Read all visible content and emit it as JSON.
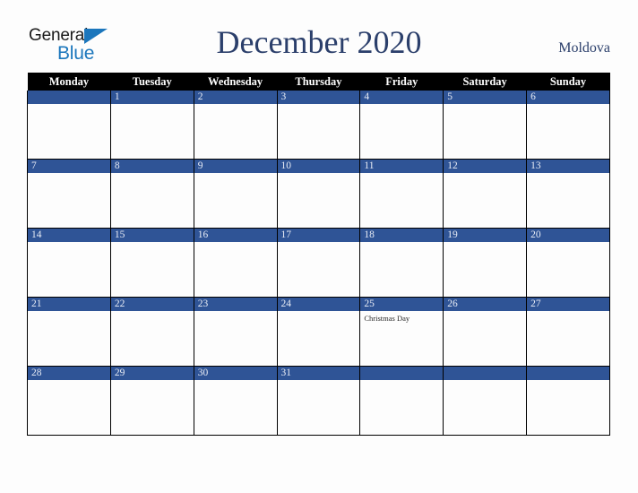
{
  "brand": {
    "line1": "General",
    "line2": "Blue",
    "triangle_icon": "blue-triangle-icon",
    "text_color": "#1a1a1a",
    "accent_color": "#1b76bc"
  },
  "header": {
    "title": "December 2020",
    "country": "Moldova",
    "title_color": "#2b3f6b"
  },
  "calendar": {
    "weekday_headers": [
      "Monday",
      "Tuesday",
      "Wednesday",
      "Thursday",
      "Friday",
      "Saturday",
      "Sunday"
    ],
    "header_bg": "#000000",
    "header_text_color": "#ffffff",
    "date_band_color": "#2f5496",
    "date_text_color": "#e8ecf5",
    "cell_bg": "#fdfdfd",
    "grid_line_color": "#000000",
    "weeks": [
      [
        {
          "date": "",
          "events": []
        },
        {
          "date": "1",
          "events": []
        },
        {
          "date": "2",
          "events": []
        },
        {
          "date": "3",
          "events": []
        },
        {
          "date": "4",
          "events": []
        },
        {
          "date": "5",
          "events": []
        },
        {
          "date": "6",
          "events": []
        }
      ],
      [
        {
          "date": "7",
          "events": []
        },
        {
          "date": "8",
          "events": []
        },
        {
          "date": "9",
          "events": []
        },
        {
          "date": "10",
          "events": []
        },
        {
          "date": "11",
          "events": []
        },
        {
          "date": "12",
          "events": []
        },
        {
          "date": "13",
          "events": []
        }
      ],
      [
        {
          "date": "14",
          "events": []
        },
        {
          "date": "15",
          "events": []
        },
        {
          "date": "16",
          "events": []
        },
        {
          "date": "17",
          "events": []
        },
        {
          "date": "18",
          "events": []
        },
        {
          "date": "19",
          "events": []
        },
        {
          "date": "20",
          "events": []
        }
      ],
      [
        {
          "date": "21",
          "events": []
        },
        {
          "date": "22",
          "events": []
        },
        {
          "date": "23",
          "events": []
        },
        {
          "date": "24",
          "events": []
        },
        {
          "date": "25",
          "events": [
            "Christmas Day"
          ]
        },
        {
          "date": "26",
          "events": []
        },
        {
          "date": "27",
          "events": []
        }
      ],
      [
        {
          "date": "28",
          "events": []
        },
        {
          "date": "29",
          "events": []
        },
        {
          "date": "30",
          "events": []
        },
        {
          "date": "31",
          "events": []
        },
        {
          "date": "",
          "events": []
        },
        {
          "date": "",
          "events": []
        },
        {
          "date": "",
          "events": []
        }
      ]
    ]
  }
}
